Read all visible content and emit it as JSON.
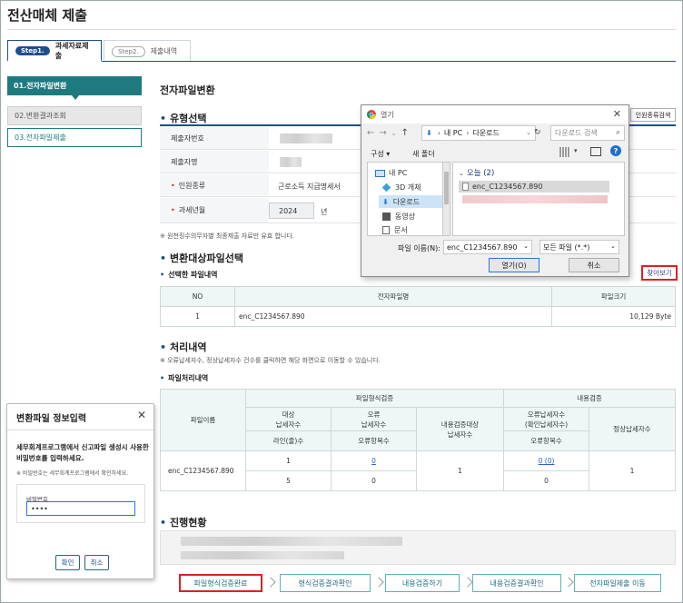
{
  "page": {
    "title": "전산매체 제출"
  },
  "tabs": [
    {
      "step": "Step1.",
      "label": "과세자료제출"
    },
    {
      "step": "Step2.",
      "label": "제출내역"
    }
  ],
  "steps": [
    "01.전자파일변환",
    "02.변환결과조회",
    "03.전자파일제출"
  ],
  "main": {
    "title": "전자파일변환",
    "type_section": "유형선택",
    "search_button": "인원종류검색",
    "fields": {
      "submitter_no": "제출자번호",
      "submitter_name": "제출자명",
      "person_type_label": "인원종류",
      "person_type_value": "근로소득 지급명세서",
      "tax_year_label": "과세년월",
      "tax_year_value": "2024",
      "tax_year_unit": "년"
    },
    "type_note": "※ 원천징수의무자별 최종제출 자료만 유효 합니다."
  },
  "file_select": {
    "section": "변환대상파일선택",
    "sub": "선택한 파일내역",
    "browse_button": "찾아보기",
    "headers": [
      "NO",
      "전자파일명",
      "파일크기"
    ],
    "rows": [
      {
        "no": "1",
        "name": "enc_C1234567.890",
        "size": "10,129 Byte"
      }
    ]
  },
  "process": {
    "section": "처리내역",
    "note": "※ 오류납세자수, 정상납세자수 건수를 클릭하면 해당 화면으로 이동할 수 있습니다.",
    "sub": "파일처리내역",
    "h_filename": "파일이름",
    "h_format": "파일형식검증",
    "h_content": "내용검증",
    "h_target": "대상\n납세자수",
    "h_error": "오류\n납세자수",
    "h_content_target": "내용검증대상\n납세자수",
    "h_content_error": "오류납세자수\n(확인납세자수)",
    "h_normal": "정상납세자수",
    "h_lines": "라인(줄)수",
    "h_error_items": "오류항목수",
    "h_error_items2": "오류항목수",
    "file": "enc_C1234567.890",
    "target": "1",
    "error": "0",
    "lines": "5",
    "error_items": "0",
    "content_target": "1",
    "content_error": "0 (0)",
    "content_error_items": "0",
    "normal": "1"
  },
  "progress": {
    "section": "진행현황",
    "buttons": [
      "파일형식검증완료",
      "형식검증결과확인",
      "내용검증하기",
      "내용검증결과확인",
      "전자파일제출 이동"
    ]
  },
  "dialog": {
    "title": "열기",
    "path": [
      "내 PC",
      "다운로드"
    ],
    "search_placeholder": "다운로드 검색",
    "organize": "구성 ▾",
    "new_folder": "새 폴더",
    "tree": [
      "내 PC",
      "3D 개체",
      "다운로드",
      "동영상",
      "문서"
    ],
    "group": "오늘 (2)",
    "files": [
      "enc_C1234567.890"
    ],
    "filename_label": "파일 이름(N):",
    "filename_value": "enc_C1234567.890",
    "filter_value": "모든 파일 (*.*)",
    "open": "열기(O)",
    "cancel": "취소"
  },
  "password_modal": {
    "title": "변환파일 정보입력",
    "desc": "세무회계프로그램에서 신고파일 생성시 사용한 비밀번호를 입력하세요.",
    "note": "※ 비밀번호는 세무회계프로그램에서 확인하세요.",
    "label": "비밀번호",
    "value": "••••",
    "confirm": "확인",
    "cancel": "취소"
  },
  "colors": {
    "accent": "#1f7a7f",
    "navy": "#1f4e8c",
    "highlight": "#e02020"
  }
}
